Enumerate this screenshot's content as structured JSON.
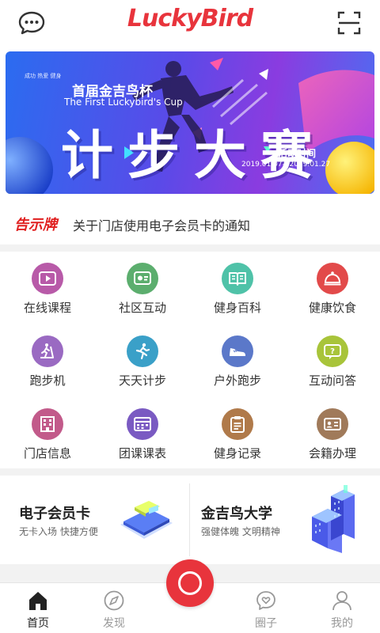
{
  "colors": {
    "brand_red": "#e8343c",
    "notice_red": "#e02020",
    "active_nav": "#222222",
    "inactive_nav": "#999999"
  },
  "header": {
    "logo": "LuckyBird",
    "left_icon": "chat-bubble-icon",
    "right_icon": "scan-icon"
  },
  "banner": {
    "small_text": "成功 热爱 健身",
    "title": "首届金吉鸟杯",
    "subtitle_en": "The First Luckybird's Cup",
    "big_text": "计步大赛",
    "activity_label": "活动时间",
    "date_range": "2019.01.07—2019.01.27"
  },
  "notice": {
    "tag": "告示牌",
    "text": "关于门店使用电子会员卡的通知"
  },
  "grid": {
    "items": [
      {
        "label": "在线课程",
        "icon": "video-play-icon",
        "color": "#b85aa8"
      },
      {
        "label": "社区互动",
        "icon": "chat-community-icon",
        "color": "#5cae6e"
      },
      {
        "label": "健身百科",
        "icon": "open-book-icon",
        "color": "#4fc2a8"
      },
      {
        "label": "健康饮食",
        "icon": "food-cloche-icon",
        "color": "#e24a4a"
      },
      {
        "label": "跑步机",
        "icon": "treadmill-icon",
        "color": "#9a6ac2"
      },
      {
        "label": "天天计步",
        "icon": "running-man-icon",
        "color": "#3aa0c8"
      },
      {
        "label": "户外跑步",
        "icon": "sneaker-icon",
        "color": "#5b78c9"
      },
      {
        "label": "互动问答",
        "icon": "qa-icon",
        "color": "#a8c43a"
      },
      {
        "label": "门店信息",
        "icon": "store-building-icon",
        "color": "#c25a8a"
      },
      {
        "label": "团课课表",
        "icon": "schedule-icon",
        "color": "#7a5ac2"
      },
      {
        "label": "健身记录",
        "icon": "clipboard-icon",
        "color": "#b07a4a"
      },
      {
        "label": "会籍办理",
        "icon": "id-card-icon",
        "color": "#a07a5a"
      }
    ]
  },
  "cards": {
    "left": {
      "title": "电子会员卡",
      "subtitle": "无卡入场 快捷方便",
      "icon": "member-card-illustration-icon"
    },
    "right": {
      "title": "金吉鸟大学",
      "subtitle": "强健体魄 文明精神",
      "icon": "university-building-illustration-icon"
    }
  },
  "nav": {
    "items": [
      {
        "label": "首页",
        "icon": "home-icon",
        "active": true
      },
      {
        "label": "发现",
        "icon": "compass-icon",
        "active": false
      },
      {
        "label": "",
        "icon": "camera-record-icon",
        "active": false
      },
      {
        "label": "圈子",
        "icon": "heart-chat-icon",
        "active": false
      },
      {
        "label": "我的",
        "icon": "user-icon",
        "active": false
      }
    ]
  }
}
